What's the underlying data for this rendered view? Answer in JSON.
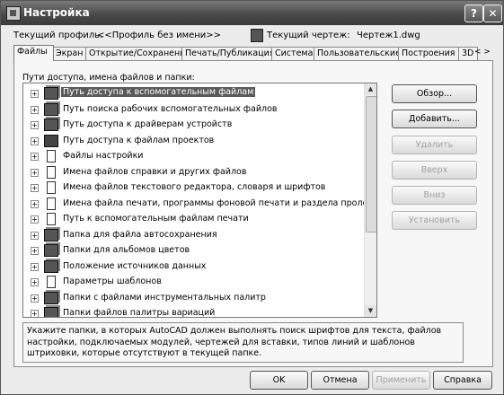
{
  "window": {
    "title": "Настройка",
    "help_button": "?",
    "close_button": "✕"
  },
  "profile": {
    "label": "Текущий профиль:",
    "value": "<<Профиль без имени>>",
    "drawing_label": "Текущий чертеж:",
    "drawing_value": "Чертеж1.dwg"
  },
  "tabs": [
    "Файлы",
    "Экран",
    "Открытие/Сохранение",
    "Печать/Публикация",
    "Система",
    "Пользовательские",
    "Построения",
    "3D"
  ],
  "tab_scroll": {
    "left": "<",
    "right": ">"
  },
  "active_tab": "Файлы",
  "files_panel": {
    "label": "Пути доступа, имена файлов и папки:",
    "items": [
      {
        "label": "Путь доступа к вспомогательным файлам",
        "icon": "folder-tree-icon",
        "selected": true
      },
      {
        "label": "Путь поиска рабочих вспомогательных файлов",
        "icon": "folder-tree-icon"
      },
      {
        "label": "Путь доступа к драйверам устройств",
        "icon": "folder-tree-icon"
      },
      {
        "label": "Путь доступа к файлам проектов",
        "icon": "project-files-icon"
      },
      {
        "label": "Файлы настройки",
        "icon": "document-icon"
      },
      {
        "label": "Имена файлов справки и других файлов",
        "icon": "document-icon"
      },
      {
        "label": "Имена файлов текстового редактора, словаря и шрифтов",
        "icon": "document-icon"
      },
      {
        "label": "Имена файла печати, программы фоновой печати и раздела пролога",
        "icon": "document-icon"
      },
      {
        "label": "Путь к вспомогательным файлам печати",
        "icon": "document-icon"
      },
      {
        "label": "Папка для файла автосохранения",
        "icon": "folder-tree-icon"
      },
      {
        "label": "Папки для альбомов цветов",
        "icon": "folder-tree-icon"
      },
      {
        "label": "Положение источников данных",
        "icon": "folder-tree-icon"
      },
      {
        "label": "Параметры шаблонов",
        "icon": "document-icon"
      },
      {
        "label": "Папки с файлами инструментальных палитр",
        "icon": "folder-tree-icon"
      },
      {
        "label": "Папки файлов палитры вариаций",
        "icon": "folder-tree-icon"
      }
    ]
  },
  "side_buttons": {
    "browse": "Обзор...",
    "add": "Добавить...",
    "remove": "Удалить",
    "up": "Вверх",
    "down": "Вниз",
    "set": "Установить"
  },
  "description": "Укажите папки, в которых AutoCAD должен выполнять поиск шрифтов для текста, файлов настройки, подключаемых модулей, чертежей для вставки, типов линий и шаблонов штриховки, которые отсутствуют в текущей папке.",
  "footer_buttons": {
    "ok": "OK",
    "cancel": "Отмена",
    "apply": "Применить",
    "help": "Справка"
  },
  "colors": {
    "titlebar": "#4a4a4a",
    "selection": "#5a5a5a"
  }
}
